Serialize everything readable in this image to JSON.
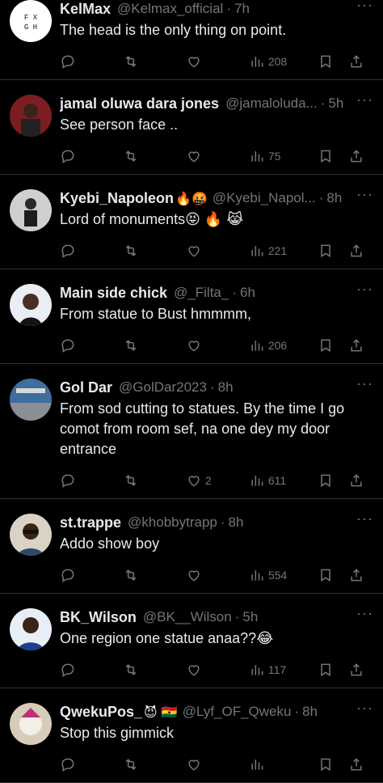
{
  "tweets": [
    {
      "name": "KelMax",
      "emoji": "",
      "handle": "@Kelmax_official",
      "time": "7h",
      "text": "The head is the only thing on point.",
      "likes": "",
      "views": "208",
      "avatar": "logo"
    },
    {
      "name": "jamal oluwa dara jones",
      "emoji": "",
      "handle": "@jamaloluda...",
      "time": "5h",
      "text": "See person face ..",
      "likes": "",
      "views": "75",
      "avatar": "red"
    },
    {
      "name": "Kyebi_Napoleon",
      "emoji": "🔥🤬",
      "handle": "@Kyebi_Napol...",
      "time": "8h",
      "text": "Lord of monuments😝 🔥 😹",
      "likes": "",
      "views": "221",
      "avatar": "gray"
    },
    {
      "name": "Main side chick",
      "emoji": "",
      "handle": "@_Filta_",
      "time": "6h",
      "text": "From statue to Bust  hmmmm,",
      "likes": "",
      "views": "206",
      "avatar": "dark"
    },
    {
      "name": "Gol Dar",
      "emoji": "",
      "handle": "@GolDar2023",
      "time": "8h",
      "text": "From sod cutting to statues. By the time I go comot from room sef, na one dey my door entrance",
      "likes": "2",
      "views": "611",
      "avatar": "blue"
    },
    {
      "name": "st.trappe",
      "emoji": "",
      "handle": "@khobbytrapp",
      "time": "8h",
      "text": "Addo show boy",
      "likes": "",
      "views": "554",
      "avatar": "light"
    },
    {
      "name": "BK_Wilson",
      "emoji": "",
      "handle": "@BK__Wilson",
      "time": "5h",
      "text": "One region one statue anaa??😂",
      "likes": "",
      "views": "117",
      "avatar": "pale"
    },
    {
      "name": "QwekuPos_",
      "emoji": "😈 🇬🇭",
      "handle": "@Lyf_OF_Qweku",
      "time": "8h",
      "text": "Stop this  gimmick",
      "likes": "",
      "views": "",
      "avatar": "pink"
    }
  ],
  "icons": {
    "reply": "reply-icon",
    "retweet": "retweet-icon",
    "like": "heart-icon",
    "views": "views-icon",
    "bookmark": "bookmark-icon",
    "share": "share-icon",
    "more": "more-icon"
  }
}
